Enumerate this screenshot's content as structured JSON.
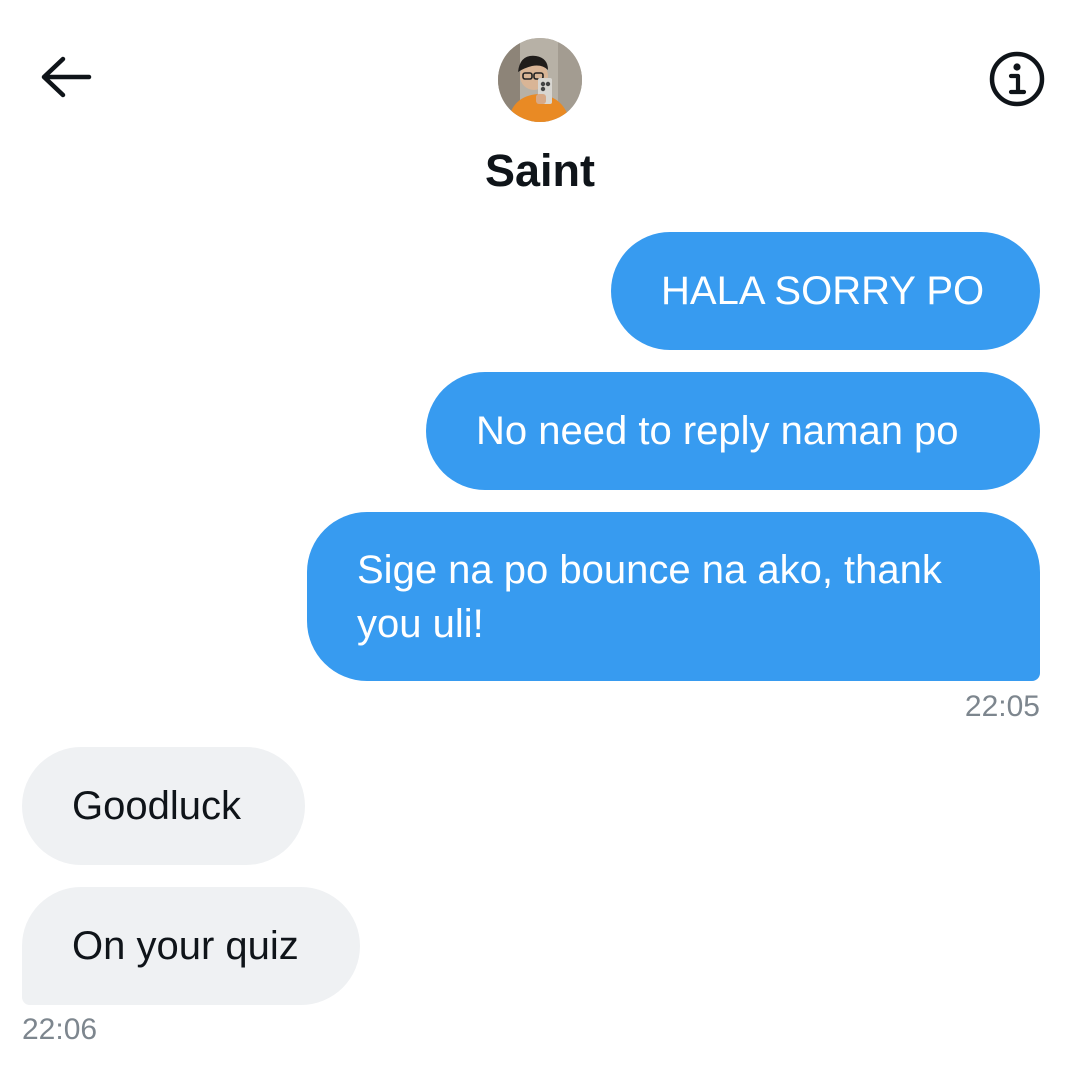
{
  "header": {
    "back_icon": "arrow-left-icon",
    "info_icon": "info-circle-icon",
    "contact_name": "Saint"
  },
  "messages": {
    "sent": [
      {
        "text": "HALA SORRY PO"
      },
      {
        "text": "No need to reply naman po"
      },
      {
        "text": "Sige na po bounce na ako, thank you uli!"
      }
    ],
    "sent_time": "22:05",
    "received": [
      {
        "text": "Goodluck"
      },
      {
        "text": "On your quiz"
      }
    ],
    "received_time": "22:06"
  },
  "colors": {
    "sent_bubble": "#379bf0",
    "received_bubble": "#eff1f3",
    "timestamp": "#7d868e"
  }
}
